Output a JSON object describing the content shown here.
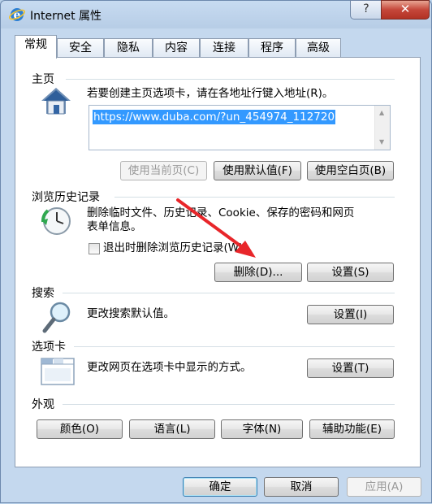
{
  "window": {
    "title": "Internet 属性",
    "help_label": "?",
    "close_label": "✕"
  },
  "tabs": [
    "常规",
    "安全",
    "隐私",
    "内容",
    "连接",
    "程序",
    "高级"
  ],
  "homepage": {
    "label": "主页",
    "description": "若要创建主页选项卡，请在各地址行键入地址(R)。",
    "url": "https://www.duba.com/?un_454974_112720",
    "buttons": {
      "use_current": "使用当前页(C)",
      "use_default": "使用默认值(F)",
      "use_blank": "使用空白页(B)"
    }
  },
  "history": {
    "label": "浏览历史记录",
    "description_line1": "删除临时文件、历史记录、Cookie、保存的密码和网页",
    "description_line2": "表单信息。",
    "checkbox_label": "退出时删除浏览历史记录(W)",
    "delete_button": "删除(D)...",
    "settings_button": "设置(S)"
  },
  "search": {
    "label": "搜索",
    "description": "更改搜索默认值。",
    "settings_button": "设置(I)"
  },
  "tabs_section": {
    "label": "选项卡",
    "description": "更改网页在选项卡中显示的方式。",
    "settings_button": "设置(T)"
  },
  "appearance": {
    "label": "外观",
    "buttons": {
      "colors": "颜色(O)",
      "languages": "语言(L)",
      "fonts": "字体(N)",
      "accessibility": "辅助功能(E)"
    }
  },
  "footer": {
    "ok": "确定",
    "cancel": "取消",
    "apply": "应用(A)"
  },
  "colors": {
    "annotation_arrow": "#e8262a",
    "selection": "#3399ff"
  },
  "icons": [
    "ie-icon",
    "home-icon",
    "history-clock-icon",
    "search-magnifier-icon",
    "tabs-window-icon"
  ]
}
